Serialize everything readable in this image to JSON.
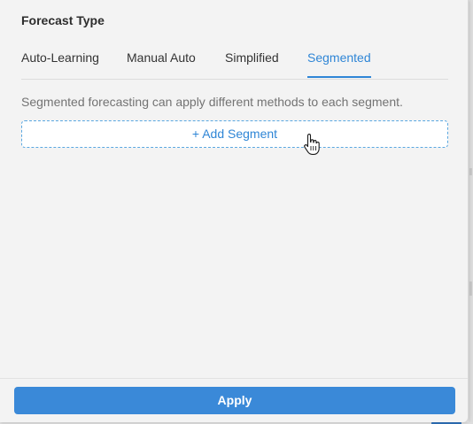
{
  "forecast_type": {
    "title": "Forecast Type",
    "tabs": [
      {
        "label": "Auto-Learning",
        "active": false
      },
      {
        "label": "Manual Auto",
        "active": false
      },
      {
        "label": "Simplified",
        "active": false
      },
      {
        "label": "Segmented",
        "active": true
      }
    ],
    "description": "Segmented forecasting can apply different methods to each segment.",
    "add_segment_label": "+ Add Segment"
  },
  "footer": {
    "apply_label": "Apply"
  },
  "colors": {
    "accent": "#2f86d6",
    "apply_background": "#3a89d8",
    "panel_background": "#f3f3f3",
    "description_text": "#737373"
  },
  "icons": {
    "cursor": "hand-pointer-icon"
  }
}
